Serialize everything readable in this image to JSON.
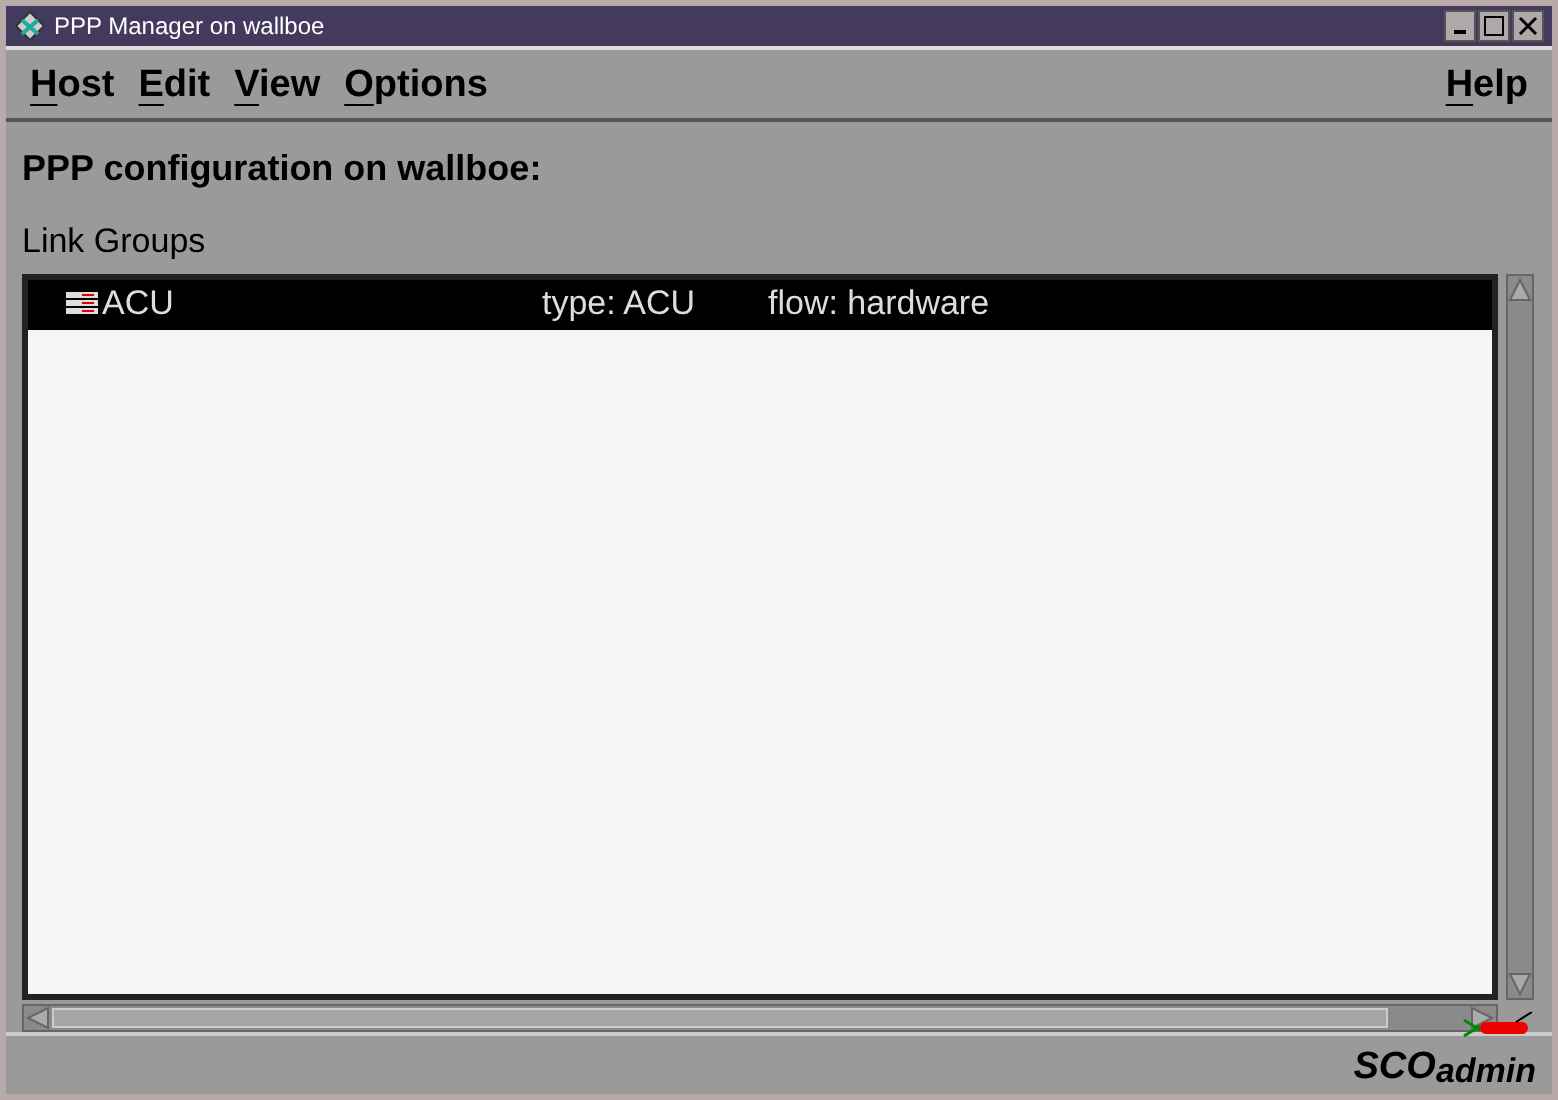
{
  "window": {
    "title": "PPP Manager on wallboe"
  },
  "menu": [
    {
      "label": "Host"
    },
    {
      "label": "Edit"
    },
    {
      "label": "View"
    },
    {
      "label": "Options"
    }
  ],
  "help_menu": {
    "label": "Help"
  },
  "heading": "PPP configuration on wallboe:",
  "list_label": "Link Groups",
  "rows": [
    {
      "name": "ACU",
      "type": "type: ACU",
      "flow": "flow: hardware",
      "selected": true
    }
  ],
  "logo": {
    "brand": "SCO",
    "product": "admin"
  }
}
